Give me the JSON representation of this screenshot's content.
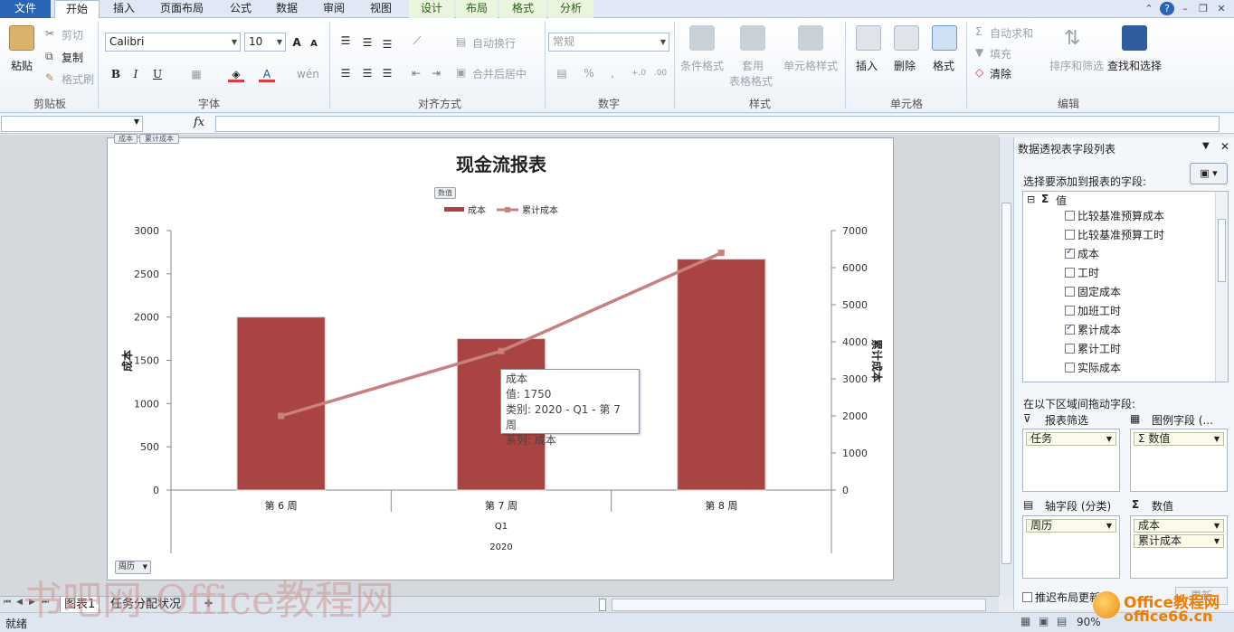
{
  "ribbon": {
    "tabs": [
      "文件",
      "开始",
      "插入",
      "页面布局",
      "公式",
      "数据",
      "审阅",
      "视图",
      "设计",
      "布局",
      "格式",
      "分析"
    ],
    "clipboard": {
      "paste": "粘贴",
      "cut": "剪切",
      "copy": "复制",
      "format_painter": "格式刷",
      "label": "剪贴板"
    },
    "font": {
      "name": "Calibri",
      "size": "10",
      "label": "字体"
    },
    "alignment": {
      "wrap": "自动换行",
      "merge": "合并后居中",
      "label": "对齐方式"
    },
    "number": {
      "format": "常规",
      "percent": "%",
      "comma": ",",
      "label": "数字"
    },
    "styles": {
      "conditional": "条件格式",
      "table_1": "套用",
      "table_2": "表格格式",
      "cell_styles": "单元格样式",
      "label": "样式"
    },
    "cells": {
      "insert": "插入",
      "delete": "删除",
      "format": "格式",
      "label": "单元格"
    },
    "editing": {
      "autosum": "自动求和",
      "fill": "填充",
      "clear": "清除",
      "sort": "排序和筛选",
      "find": "查找和选择",
      "label": "编辑"
    }
  },
  "formula_bar": {
    "fx": "fx"
  },
  "chart": {
    "field_buttons": {
      "top_1": "成本",
      "top_2": "累计成本",
      "values": "数值",
      "axis": "周历"
    },
    "tooltip": {
      "line1": "成本",
      "line2": "值: 1750",
      "line3": "类别: 2020 - Q1 - 第 7 周",
      "line4": "系列: 成本"
    }
  },
  "chart_data": {
    "type": "bar",
    "title": "现金流报表",
    "categories": [
      "第 6 周",
      "第 7 周",
      "第 8 周"
    ],
    "category_groups": [
      "Q1",
      "2020"
    ],
    "series": [
      {
        "name": "成本",
        "type": "bar",
        "axis": "left",
        "values": [
          2000,
          1750,
          2670
        ],
        "color": "#a94442"
      },
      {
        "name": "累计成本",
        "type": "line",
        "axis": "right",
        "values": [
          2000,
          3750,
          6400
        ],
        "color": "#c8817e"
      }
    ],
    "ylabel": "成本",
    "y2label": "累计成本",
    "ylim": [
      0,
      3000
    ],
    "y2lim": [
      0,
      7000
    ],
    "yticks": [
      "0",
      "500",
      "1000",
      "1500",
      "2000",
      "2500",
      "3000"
    ],
    "y2ticks": [
      "0",
      "1000",
      "2000",
      "3000",
      "4000",
      "5000",
      "6000",
      "7000"
    ],
    "legend": "top"
  },
  "pivot_pane": {
    "title": "数据透视表字段列表",
    "choose": "选择要添加到报表的字段:",
    "group": "值",
    "fields": [
      {
        "label": "比较基准预算成本",
        "checked": false
      },
      {
        "label": "比较基准预算工时",
        "checked": false
      },
      {
        "label": "成本",
        "checked": true
      },
      {
        "label": "工时",
        "checked": false
      },
      {
        "label": "固定成本",
        "checked": false
      },
      {
        "label": "加班工时",
        "checked": false
      },
      {
        "label": "累计成本",
        "checked": true
      },
      {
        "label": "累计工时",
        "checked": false
      },
      {
        "label": "实际成本",
        "checked": false
      }
    ],
    "drag_label": "在以下区域间拖动字段:",
    "report_filter": "报表筛选",
    "legend_fields": "图例字段 (...",
    "axis_fields": "轴字段 (分类)",
    "values": "数值",
    "filter_item": "任务",
    "legend_item": "Σ 数值",
    "axis_item": "周历",
    "value_items": [
      "成本",
      "累计成本"
    ],
    "defer": "推迟布局更新",
    "update": "更新"
  },
  "sheet_tabs": [
    "图表1",
    "任务分配状况"
  ],
  "status": {
    "ready": "就绪",
    "zoom": "90%"
  },
  "watermark": "书吧网-Office教程网",
  "brand": {
    "name": "Office教程网",
    "url": "office66.cn"
  }
}
